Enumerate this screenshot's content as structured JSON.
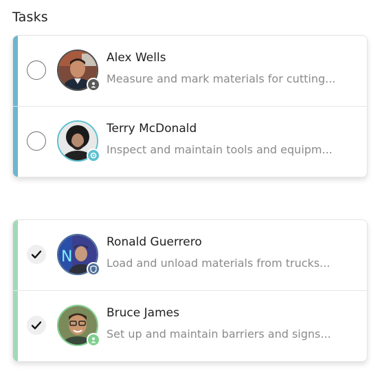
{
  "header": {
    "title": "Tasks"
  },
  "colors": {
    "pending_accent": "#6eb6cc",
    "done_accent": "#a4d8b8"
  },
  "groups": [
    {
      "status": "pending",
      "tasks": [
        {
          "name": "Alex Wells",
          "description": "Measure and mark materials for cutting...",
          "checked": false,
          "badge_icon": "user-icon"
        },
        {
          "name": "Terry McDonald",
          "description": "Inspect and maintain tools and equipm...",
          "checked": false,
          "badge_icon": "gear-icon"
        }
      ]
    },
    {
      "status": "completed",
      "tasks": [
        {
          "name": "Ronald Guerrero",
          "description": "Load and unload materials from trucks...",
          "checked": true,
          "badge_icon": "shield-icon"
        },
        {
          "name": "Bruce James",
          "description": "Set up and maintain barriers and signs...",
          "checked": true,
          "badge_icon": "user-icon"
        }
      ]
    }
  ]
}
